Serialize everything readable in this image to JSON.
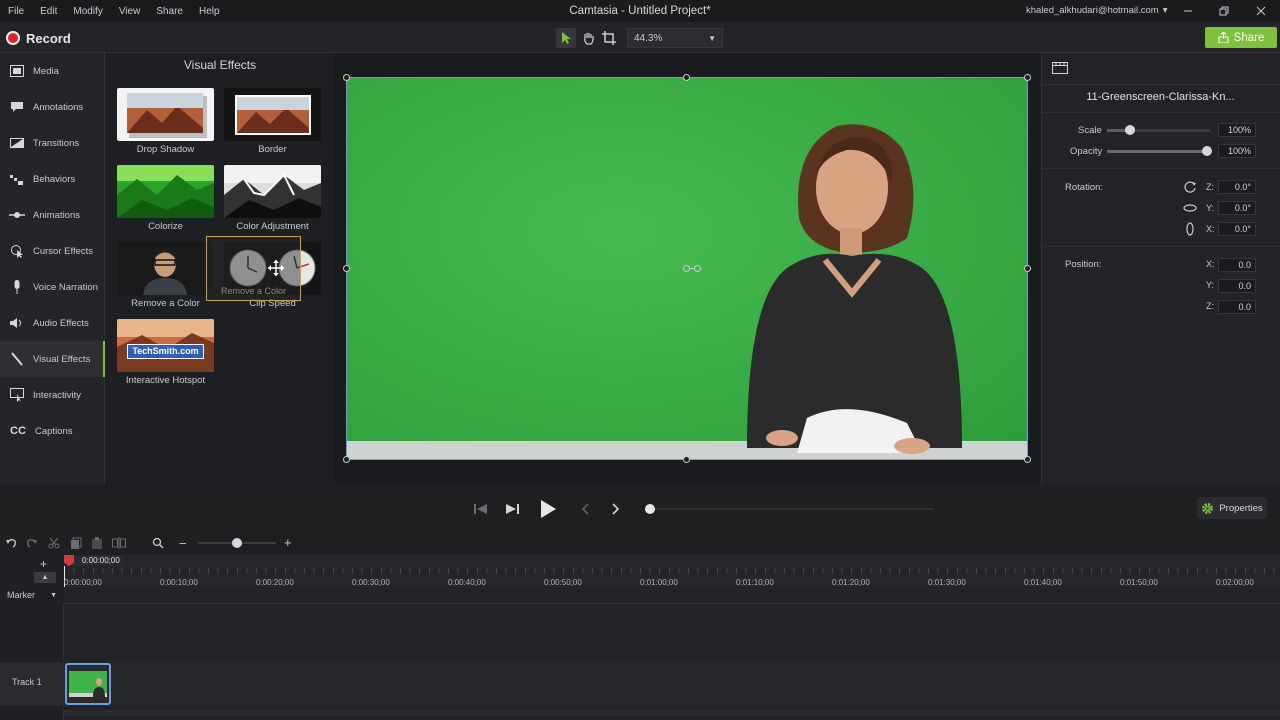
{
  "menu": [
    "File",
    "Edit",
    "Modify",
    "View",
    "Share",
    "Help"
  ],
  "app_title": "Camtasia - Untitled Project*",
  "account": "khaled_alkhudari@hotmail.com",
  "toolbar": {
    "record_label": "Record",
    "zoom": "44.3%",
    "share_label": "Share"
  },
  "sidebar": {
    "items": [
      {
        "label": "Media",
        "icon": "media-icon"
      },
      {
        "label": "Annotations",
        "icon": "annotations-icon"
      },
      {
        "label": "Transitions",
        "icon": "transitions-icon"
      },
      {
        "label": "Behaviors",
        "icon": "behaviors-icon"
      },
      {
        "label": "Animations",
        "icon": "animations-icon"
      },
      {
        "label": "Cursor Effects",
        "icon": "cursor-effects-icon"
      },
      {
        "label": "Voice Narration",
        "icon": "microphone-icon"
      },
      {
        "label": "Audio Effects",
        "icon": "speaker-icon"
      },
      {
        "label": "Visual Effects",
        "icon": "wand-icon",
        "active": true
      },
      {
        "label": "Interactivity",
        "icon": "interactivity-icon"
      },
      {
        "label": "Captions",
        "icon": "cc-icon"
      }
    ]
  },
  "effects": {
    "title": "Visual Effects",
    "tiles": [
      "Drop Shadow",
      "Border",
      "Colorize",
      "Color Adjustment",
      "Remove a Color",
      "Clip Speed",
      "Interactive Hotspot"
    ],
    "hotspot_badge": "TechSmith.com",
    "drag_ghost_label": "Remove a Color"
  },
  "properties": {
    "clip_name": "11-Greenscreen-Clarissa-Kn...",
    "scale_label": "Scale",
    "scale_value": "100%",
    "opacity_label": "Opacity",
    "opacity_value": "100%",
    "rotation_label": "Rotation:",
    "rot_z": "0.0°",
    "rot_y": "0.0°",
    "rot_x": "0.0°",
    "position_label": "Position:",
    "pos_x": "0.0",
    "pos_y": "0.0",
    "pos_z": "0.0",
    "axis_z": "Z:",
    "axis_y": "Y:",
    "axis_x": "X:"
  },
  "playback": {
    "properties_label": "Properties"
  },
  "timeline": {
    "playhead_time": "0:00:00;00",
    "ticks": [
      "0:00:00;00",
      "0:00:10;00",
      "0:00:20;00",
      "0:00:30;00",
      "0:00:40;00",
      "0:00:50;00",
      "0:01:00;00",
      "0:01:10;00",
      "0:01:20;00",
      "0:01:30;00",
      "0:01:40;00",
      "0:01:50;00",
      "0:02:00;00"
    ],
    "marker_label": "Marker",
    "track_label": "Track 1"
  },
  "colors": {
    "accent": "#7dc13d",
    "record": "#e0212b",
    "selection": "#6b9ee0",
    "green_screen": "#3fb24a"
  }
}
